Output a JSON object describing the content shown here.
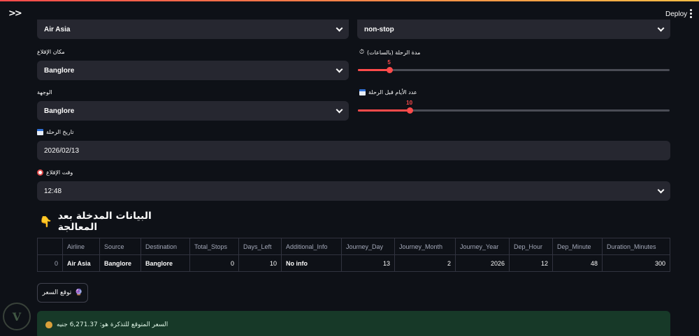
{
  "header": {
    "deploy_label": "Deploy"
  },
  "form": {
    "airline_value": "Air Asia",
    "stops_value": "non-stop",
    "source": {
      "label": "مكان الإقلاع",
      "value": "Banglore"
    },
    "destination": {
      "label": "الوجهة",
      "value": "Banglore"
    },
    "duration": {
      "label": "مدة الرحلة (بالساعات)",
      "value": "5",
      "fraction": 0.1
    },
    "days_left": {
      "label": "عدد الأيام قبل الرحلة",
      "value": "10",
      "fraction": 0.165
    },
    "journey_date": {
      "label": "تاريخ الرحلة",
      "value": "2026/02/13"
    },
    "departure_time": {
      "label": "وقت الإقلاع",
      "value": "12:48"
    }
  },
  "processed": {
    "heading": "البيانات المدخلة بعد المعالجة",
    "columns": [
      "",
      "Airline",
      "Source",
      "Destination",
      "Total_Stops",
      "Days_Left",
      "Additional_Info",
      "Journey_Day",
      "Journey_Month",
      "Journey_Year",
      "Dep_Hour",
      "Dep_Minute",
      "Duration_Minutes"
    ],
    "row": [
      "0",
      "Air Asia",
      "Banglore",
      "Banglore",
      "0",
      "10",
      "No info",
      "13",
      "2",
      "2026",
      "12",
      "48",
      "300"
    ]
  },
  "predict_button": "توقع السعر",
  "result_text": "السعر المتوقع للتذكرة هو: 6,271.37 جنيه",
  "colors": {
    "accent": "#ff4b4b",
    "success_bg": "#173928",
    "widget_bg": "#262730"
  }
}
